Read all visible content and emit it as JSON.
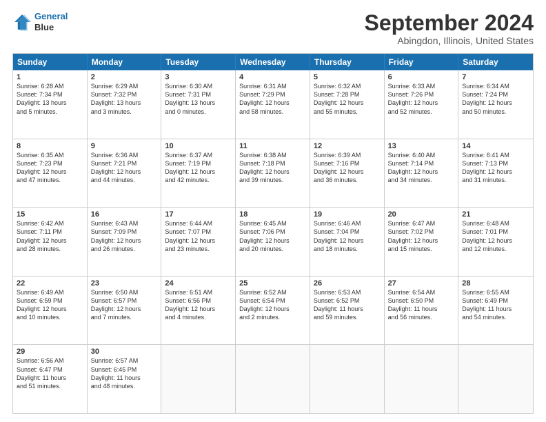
{
  "logo": {
    "line1": "General",
    "line2": "Blue"
  },
  "title": "September 2024",
  "location": "Abingdon, Illinois, United States",
  "days": [
    "Sunday",
    "Monday",
    "Tuesday",
    "Wednesday",
    "Thursday",
    "Friday",
    "Saturday"
  ],
  "rows": [
    [
      {
        "day": "1",
        "info": "Sunrise: 6:28 AM\nSunset: 7:34 PM\nDaylight: 13 hours\nand 5 minutes."
      },
      {
        "day": "2",
        "info": "Sunrise: 6:29 AM\nSunset: 7:32 PM\nDaylight: 13 hours\nand 3 minutes."
      },
      {
        "day": "3",
        "info": "Sunrise: 6:30 AM\nSunset: 7:31 PM\nDaylight: 13 hours\nand 0 minutes."
      },
      {
        "day": "4",
        "info": "Sunrise: 6:31 AM\nSunset: 7:29 PM\nDaylight: 12 hours\nand 58 minutes."
      },
      {
        "day": "5",
        "info": "Sunrise: 6:32 AM\nSunset: 7:28 PM\nDaylight: 12 hours\nand 55 minutes."
      },
      {
        "day": "6",
        "info": "Sunrise: 6:33 AM\nSunset: 7:26 PM\nDaylight: 12 hours\nand 52 minutes."
      },
      {
        "day": "7",
        "info": "Sunrise: 6:34 AM\nSunset: 7:24 PM\nDaylight: 12 hours\nand 50 minutes."
      }
    ],
    [
      {
        "day": "8",
        "info": "Sunrise: 6:35 AM\nSunset: 7:23 PM\nDaylight: 12 hours\nand 47 minutes."
      },
      {
        "day": "9",
        "info": "Sunrise: 6:36 AM\nSunset: 7:21 PM\nDaylight: 12 hours\nand 44 minutes."
      },
      {
        "day": "10",
        "info": "Sunrise: 6:37 AM\nSunset: 7:19 PM\nDaylight: 12 hours\nand 42 minutes."
      },
      {
        "day": "11",
        "info": "Sunrise: 6:38 AM\nSunset: 7:18 PM\nDaylight: 12 hours\nand 39 minutes."
      },
      {
        "day": "12",
        "info": "Sunrise: 6:39 AM\nSunset: 7:16 PM\nDaylight: 12 hours\nand 36 minutes."
      },
      {
        "day": "13",
        "info": "Sunrise: 6:40 AM\nSunset: 7:14 PM\nDaylight: 12 hours\nand 34 minutes."
      },
      {
        "day": "14",
        "info": "Sunrise: 6:41 AM\nSunset: 7:13 PM\nDaylight: 12 hours\nand 31 minutes."
      }
    ],
    [
      {
        "day": "15",
        "info": "Sunrise: 6:42 AM\nSunset: 7:11 PM\nDaylight: 12 hours\nand 28 minutes."
      },
      {
        "day": "16",
        "info": "Sunrise: 6:43 AM\nSunset: 7:09 PM\nDaylight: 12 hours\nand 26 minutes."
      },
      {
        "day": "17",
        "info": "Sunrise: 6:44 AM\nSunset: 7:07 PM\nDaylight: 12 hours\nand 23 minutes."
      },
      {
        "day": "18",
        "info": "Sunrise: 6:45 AM\nSunset: 7:06 PM\nDaylight: 12 hours\nand 20 minutes."
      },
      {
        "day": "19",
        "info": "Sunrise: 6:46 AM\nSunset: 7:04 PM\nDaylight: 12 hours\nand 18 minutes."
      },
      {
        "day": "20",
        "info": "Sunrise: 6:47 AM\nSunset: 7:02 PM\nDaylight: 12 hours\nand 15 minutes."
      },
      {
        "day": "21",
        "info": "Sunrise: 6:48 AM\nSunset: 7:01 PM\nDaylight: 12 hours\nand 12 minutes."
      }
    ],
    [
      {
        "day": "22",
        "info": "Sunrise: 6:49 AM\nSunset: 6:59 PM\nDaylight: 12 hours\nand 10 minutes."
      },
      {
        "day": "23",
        "info": "Sunrise: 6:50 AM\nSunset: 6:57 PM\nDaylight: 12 hours\nand 7 minutes."
      },
      {
        "day": "24",
        "info": "Sunrise: 6:51 AM\nSunset: 6:56 PM\nDaylight: 12 hours\nand 4 minutes."
      },
      {
        "day": "25",
        "info": "Sunrise: 6:52 AM\nSunset: 6:54 PM\nDaylight: 12 hours\nand 2 minutes."
      },
      {
        "day": "26",
        "info": "Sunrise: 6:53 AM\nSunset: 6:52 PM\nDaylight: 11 hours\nand 59 minutes."
      },
      {
        "day": "27",
        "info": "Sunrise: 6:54 AM\nSunset: 6:50 PM\nDaylight: 11 hours\nand 56 minutes."
      },
      {
        "day": "28",
        "info": "Sunrise: 6:55 AM\nSunset: 6:49 PM\nDaylight: 11 hours\nand 54 minutes."
      }
    ],
    [
      {
        "day": "29",
        "info": "Sunrise: 6:56 AM\nSunset: 6:47 PM\nDaylight: 11 hours\nand 51 minutes."
      },
      {
        "day": "30",
        "info": "Sunrise: 6:57 AM\nSunset: 6:45 PM\nDaylight: 11 hours\nand 48 minutes."
      },
      {
        "day": "",
        "info": ""
      },
      {
        "day": "",
        "info": ""
      },
      {
        "day": "",
        "info": ""
      },
      {
        "day": "",
        "info": ""
      },
      {
        "day": "",
        "info": ""
      }
    ]
  ]
}
